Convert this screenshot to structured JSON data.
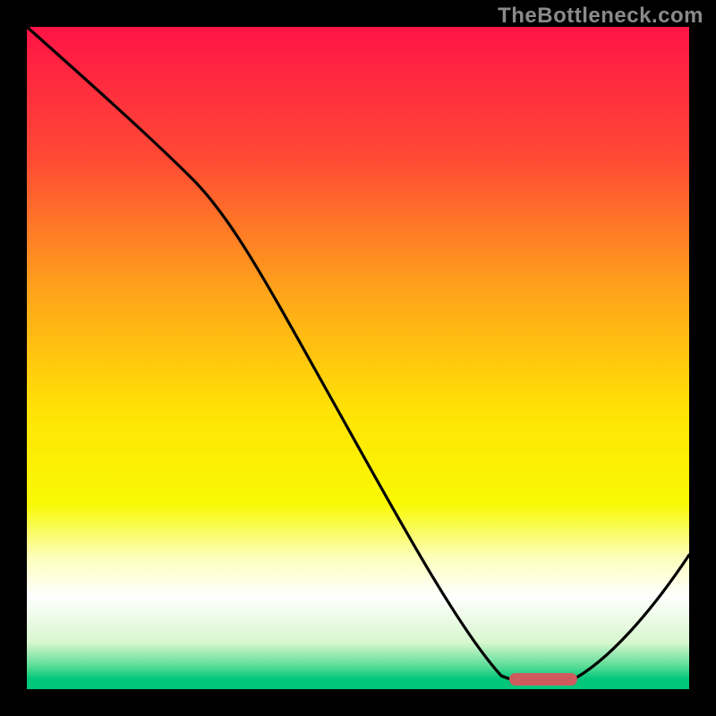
{
  "watermark": "TheBottleneck.com",
  "chart_data": {
    "type": "line",
    "title": "",
    "xlabel": "",
    "ylabel": "",
    "xlim": [
      0,
      100
    ],
    "ylim": [
      0,
      100
    ],
    "axes_visible": false,
    "background_gradient": {
      "stops": [
        {
          "offset": 0.0,
          "color": "#ff1446"
        },
        {
          "offset": 0.2,
          "color": "#ff4a34"
        },
        {
          "offset": 0.4,
          "color": "#ffa41a"
        },
        {
          "offset": 0.58,
          "color": "#ffe305"
        },
        {
          "offset": 0.72,
          "color": "#f9f904"
        },
        {
          "offset": 0.8,
          "color": "#fcffb9"
        },
        {
          "offset": 0.86,
          "color": "#ffffff"
        },
        {
          "offset": 0.93,
          "color": "#d7f7ce"
        },
        {
          "offset": 0.965,
          "color": "#5bdc97"
        },
        {
          "offset": 0.985,
          "color": "#00c77a"
        },
        {
          "offset": 1.0,
          "color": "#00c77a"
        }
      ]
    },
    "series": [
      {
        "name": "bottleneck-curve",
        "x": [
          0,
          25,
          72,
          78,
          82,
          100
        ],
        "y": [
          100,
          77,
          2,
          1,
          1,
          22
        ]
      }
    ],
    "marker": {
      "name": "optimal-range",
      "shape": "rounded-bar",
      "x_center": 78,
      "y": 1.3,
      "width": 10,
      "color": "#cf5a5e"
    },
    "interpretation": "Vertical axis ~ bottleneck %, horizontal axis ~ resolution/setting; curve reaches minimum (~1%) around x≈75–82 marked by the red bar, then rises again."
  }
}
